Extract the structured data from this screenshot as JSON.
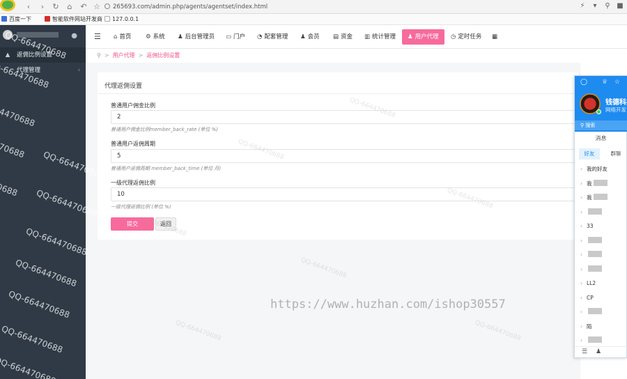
{
  "browser": {
    "url": "265693.com/admin.php/agents/agentset/index.html",
    "bookmarks": [
      "百度一下",
      "智能软件网站开发商",
      "127.0.0.1"
    ]
  },
  "sidebar": {
    "items": [
      {
        "label": "返佣比例设置",
        "icon": "home-icon"
      },
      {
        "label": "代理管理",
        "icon": "none"
      }
    ]
  },
  "topnav": {
    "items": [
      {
        "label": "首页",
        "icon": "home-icon"
      },
      {
        "label": "系统",
        "icon": "gear-icon"
      },
      {
        "label": "后台管理员",
        "icon": "user-icon"
      },
      {
        "label": "门户",
        "icon": "id-card-icon"
      },
      {
        "label": "配套管理",
        "icon": "palette-icon"
      },
      {
        "label": "会员",
        "icon": "users-icon"
      },
      {
        "label": "资金",
        "icon": "money-icon"
      },
      {
        "label": "统计管理",
        "icon": "chart-icon"
      },
      {
        "label": "用户代理",
        "icon": "user-agent-icon"
      },
      {
        "label": "定时任务",
        "icon": "clock-icon"
      }
    ]
  },
  "breadcrumb": {
    "level1": "用户代理",
    "level2": "返佣比例设置"
  },
  "form": {
    "title": "代理返佣设置",
    "fields": [
      {
        "label": "普通用户佣金比例",
        "value": "2",
        "help": "普通用户佣金比例member_back_rate (单位 %)"
      },
      {
        "label": "普通用户返佣周期",
        "value": "5",
        "help": "普通用户返佣周期 member_back_time (单位 月)"
      },
      {
        "label": "一级代理返佣比例",
        "value": "10",
        "help": "一级代理返佣比例 (单位 %)"
      }
    ],
    "submit_label": "提交",
    "back_label": "返回"
  },
  "qq": {
    "name": "钱德科技",
    "signature": "网络开发",
    "search_placeholder": "搜索",
    "messages_tab": "消息",
    "tabs": [
      "好友",
      "群聊"
    ],
    "groups": [
      "我的好友",
      "我",
      "我",
      "",
      "33",
      "",
      "",
      "",
      "LL2",
      "CP",
      "",
      "陌",
      ""
    ]
  },
  "watermark": {
    "text": "QQ-664470688",
    "url": "https://www.huzhan.com/ishop30557"
  }
}
